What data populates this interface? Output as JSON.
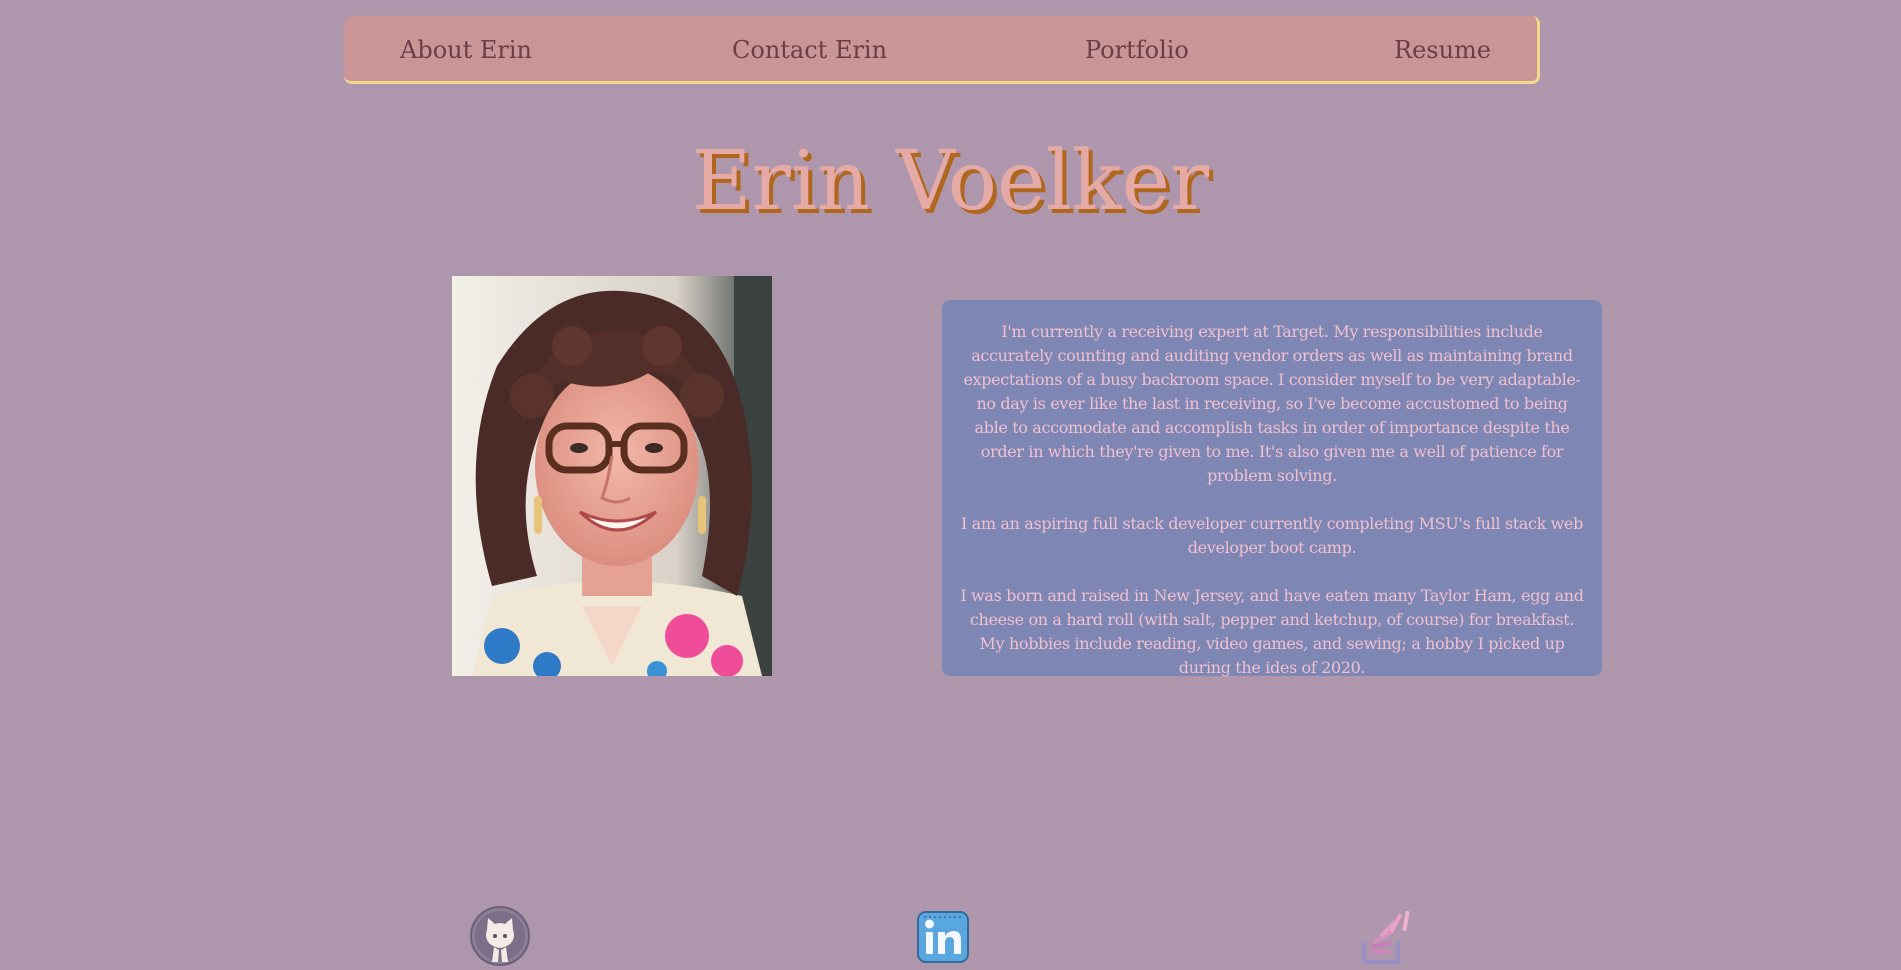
{
  "nav": {
    "items": [
      {
        "label": "About Erin"
      },
      {
        "label": "Contact Erin"
      },
      {
        "label": "Portfolio"
      },
      {
        "label": "Resume"
      }
    ]
  },
  "header": {
    "title": "Erin Voelker"
  },
  "profile": {
    "photo_alt": "Portrait of Erin Voelker"
  },
  "bio": {
    "paragraphs": [
      "I'm currently a receiving expert at Target. My responsibilities include accurately counting and auditing vendor orders as well as maintaining brand expectations of a busy backroom space. I consider myself to be very adaptable- no day is ever like the last in receiving, so I've become accustomed to being able to accomodate and accomplish tasks in order of importance despite the order in which they're given to me. It's also given me a well of patience for problem solving.",
      "I am an aspiring full stack developer currently completing MSU's full stack web developer boot camp.",
      "I was born and raised in New Jersey, and have eaten many Taylor Ham, egg and cheese on a hard roll (with salt, pepper and ketchup, of course) for breakfast. My hobbies include reading, video games, and sewing; a hobby I picked up during the ides of 2020."
    ]
  },
  "social": {
    "icons": [
      "github-icon",
      "linkedin-icon",
      "stackoverflow-icon"
    ]
  },
  "colors": {
    "background": "#ae97ad",
    "nav_bg": "#c99597",
    "nav_border": "#f1d98a",
    "nav_text": "#6b3d47",
    "title": "#e5aaa6",
    "title_shadow": "#b0661c",
    "bio_bg": "#7e86b4",
    "bio_text": "#f0c0cf"
  }
}
